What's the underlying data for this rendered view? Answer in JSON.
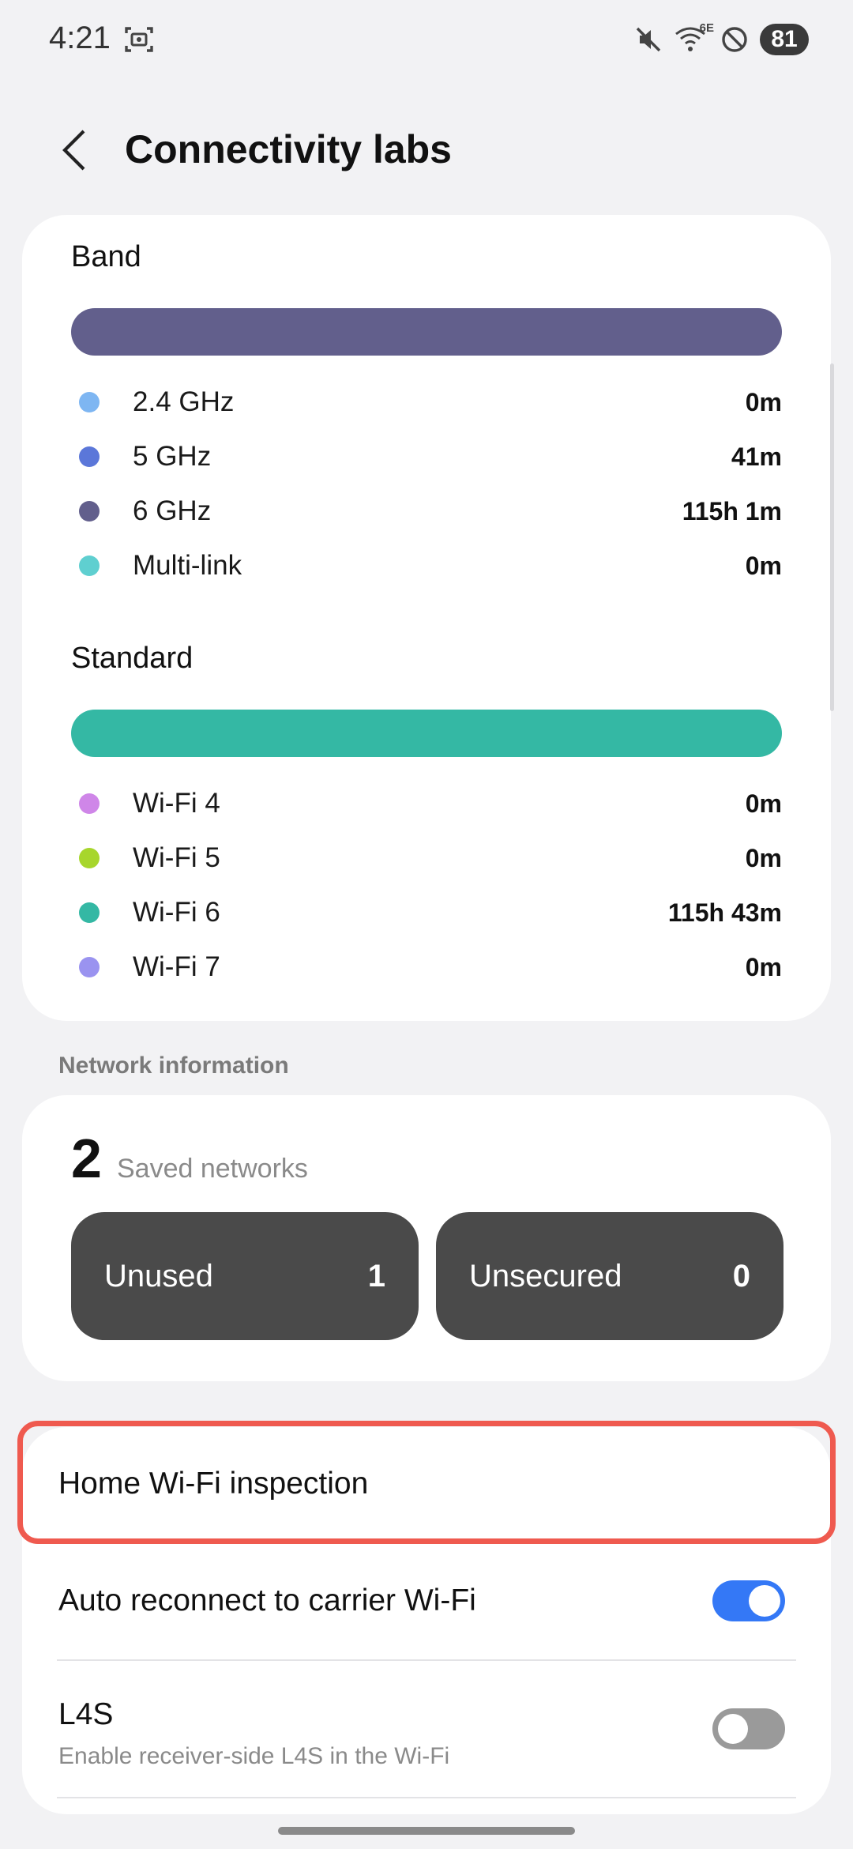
{
  "status_bar": {
    "time": "4:21",
    "battery": "81",
    "wifi_badge": "6E"
  },
  "header": {
    "title": "Connectivity labs"
  },
  "band": {
    "title": "Band",
    "bar_color": "#625f8c",
    "items": [
      {
        "label": "2.4 GHz",
        "value": "0m",
        "color": "#7eb6f2"
      },
      {
        "label": "5 GHz",
        "value": "41m",
        "color": "#5b77d9"
      },
      {
        "label": "6 GHz",
        "value": "115h 1m",
        "color": "#625f8c"
      },
      {
        "label": "Multi-link",
        "value": "0m",
        "color": "#5fcfd0"
      }
    ]
  },
  "standard": {
    "title": "Standard",
    "bar_color": "#34b8a4",
    "items": [
      {
        "label": "Wi-Fi 4",
        "value": "0m",
        "color": "#cf86e8"
      },
      {
        "label": "Wi-Fi 5",
        "value": "0m",
        "color": "#a7d62c"
      },
      {
        "label": "Wi-Fi 6",
        "value": "115h 43m",
        "color": "#34b8a4"
      },
      {
        "label": "Wi-Fi 7",
        "value": "0m",
        "color": "#9a93f0"
      }
    ]
  },
  "network_info": {
    "header": "Network information",
    "saved_count": "2",
    "saved_label": "Saved networks",
    "unused_label": "Unused",
    "unused_value": "1",
    "unsecured_label": "Unsecured",
    "unsecured_value": "0"
  },
  "settings": {
    "home_wifi": {
      "title": "Home Wi-Fi inspection"
    },
    "auto_reconnect": {
      "title": "Auto reconnect to carrier Wi-Fi",
      "enabled": true
    },
    "l4s": {
      "title": "L4S",
      "subtitle": "Enable receiver-side L4S in the Wi-Fi",
      "enabled": false
    }
  },
  "colors": {
    "accent": "#3478f6",
    "highlight": "#ef5a4f",
    "pill": "#4a4a4a"
  }
}
